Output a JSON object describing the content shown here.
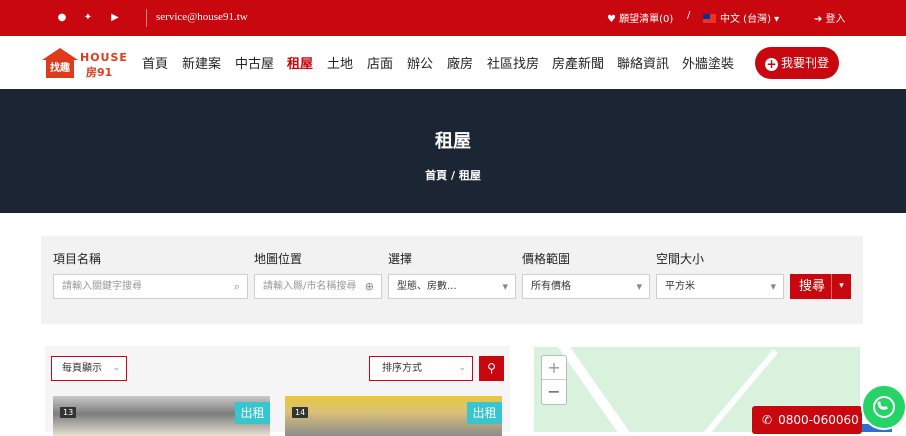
{
  "topbar": {
    "email": "service@house91.tw",
    "wishlist": "♥ 願望清單(0)",
    "slash": "/",
    "language": "中文 (台灣) ▾",
    "login": "➔ 登入",
    "social_icons": [
      "facebook-icon",
      "twitter-icon",
      "youtube-icon"
    ]
  },
  "logo": {
    "house_text": "找趣",
    "brand_top": "HOUSE",
    "brand_bottom": "房91"
  },
  "nav": {
    "items": [
      "首頁",
      "新建案",
      "中古屋",
      "租屋",
      "土地",
      "店面",
      "辦公",
      "廠房",
      "社區找房",
      "房產新聞",
      "聯絡資訊",
      "外牆塗裝"
    ],
    "active": "租屋",
    "publish_label": "我要刊登",
    "publish_icon": "+"
  },
  "hero": {
    "title": "租屋",
    "breadcrumb": "首頁  /  租屋"
  },
  "search": {
    "labels": {
      "project": "項目名稱",
      "map": "地圖位置",
      "select": "選擇",
      "price": "價格範圍",
      "space": "空間大小"
    },
    "project_placeholder": "請輸入關鍵字搜尋",
    "map_placeholder": "請輸入縣/市名稱搜尋",
    "select_value": "型態、房數...",
    "price_value": "所有價格",
    "space_value": "平方米",
    "button_label": "搜尋",
    "button_caret": "▾",
    "search_glyph": "⌕",
    "locate_glyph": "⊕",
    "dropdown_glyph": "▾"
  },
  "listing": {
    "per_page": "每頁顯示",
    "per_page_caret": "⌄",
    "sort_label": "排序方式",
    "sort_caret": "⌄",
    "map_pin_glyph": "⚲",
    "cards": [
      {
        "count": "13",
        "badge": "出租"
      },
      {
        "count": "14",
        "badge": "出租"
      }
    ]
  },
  "map": {
    "zoom_in": "+",
    "zoom_out": "−"
  },
  "contact": {
    "phone": "0800-060060",
    "phone_glyph": "✆"
  },
  "colors": {
    "brand_red": "#c8070f",
    "hero_bg": "#1c2533",
    "badge_teal": "#39c5cf",
    "whatsapp_green": "#25d366"
  }
}
